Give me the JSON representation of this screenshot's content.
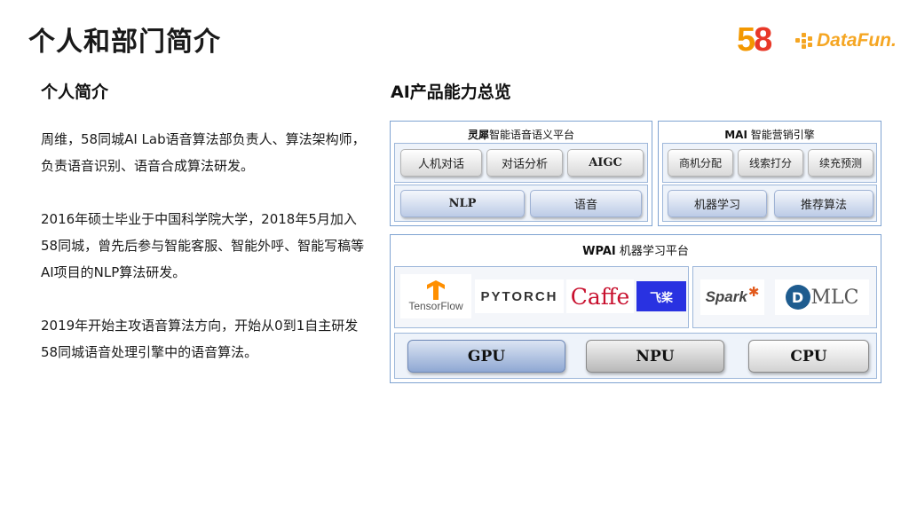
{
  "slide": {
    "title": "个人和部门简介"
  },
  "logos": {
    "logo_58": "58",
    "logo_datafun": "DataFun."
  },
  "left": {
    "heading": "个人简介",
    "paragraphs": [
      "周维，58同城AI Lab语音算法部负责人、算法架构师，负责语音识别、语音合成算法研发。",
      "2016年硕士毕业于中国科学院大学，2018年5月加入58同城，曾先后参与智能客服、智能外呼、智能写稿等AI项目的NLP算法研发。",
      "2019年开始主攻语音算法方向，开始从0到1自主研发58同城语音处理引擎中的语音算法。"
    ]
  },
  "right": {
    "heading": "AI产品能力总览",
    "lingxi": {
      "title_bold": "灵犀",
      "title_rest": "智能语音语义平台",
      "chips": [
        "人机对话",
        "对话分析",
        "AIGC"
      ],
      "bottom": [
        "NLP",
        "语音"
      ]
    },
    "mai": {
      "title_bold": "MAI",
      "title_rest": " 智能营销引擎",
      "chips": [
        "商机分配",
        "线索打分",
        "续充预测"
      ],
      "bottom": [
        "机器学习",
        "推荐算法"
      ]
    },
    "wpai": {
      "title_bold": "WPAI",
      "title_rest": " 机器学习平台",
      "frameworks": [
        "TensorFlow",
        "PYTORCH",
        "Caffe",
        "飞桨",
        "Spark",
        "MLC"
      ],
      "hardware": [
        "GPU",
        "NPU",
        "CPU"
      ]
    }
  },
  "colors": {
    "frame_blue": "#7fa3d1",
    "tf_orange": "#ff8f00",
    "torch_red": "#ee4c2c",
    "caffe_red": "#c8102e",
    "paddle_blue": "#2932e1",
    "dmlc_blue": "#1e5c8f",
    "spark_orange": "#e25a1c"
  }
}
